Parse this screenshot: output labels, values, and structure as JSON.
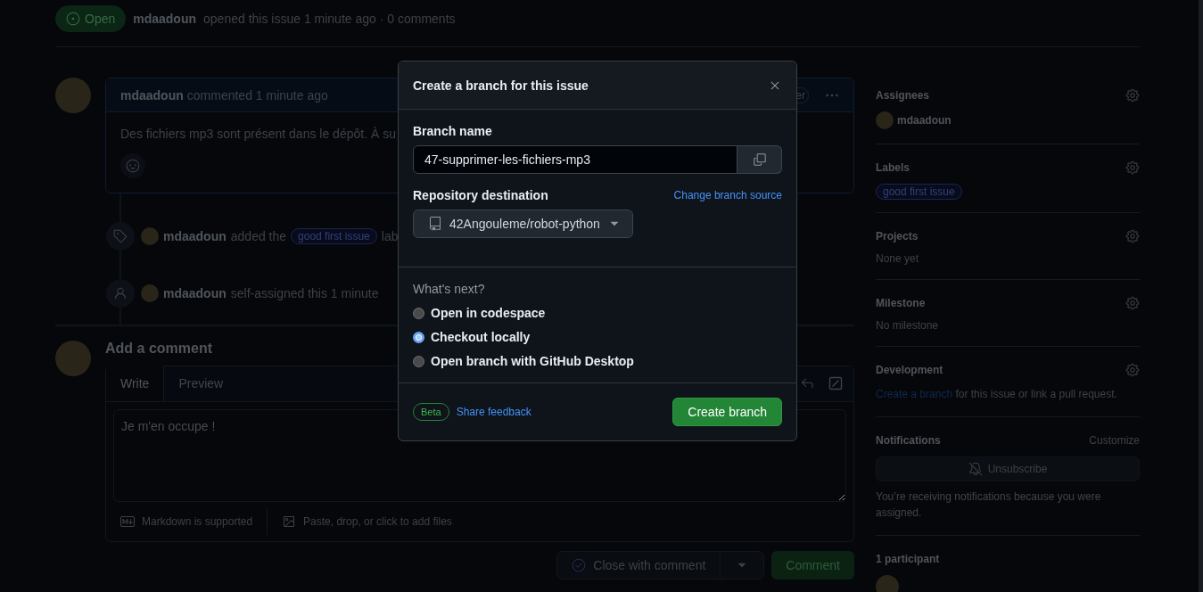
{
  "issue_header": {
    "state": "Open",
    "author": "mdaadoun",
    "meta": "opened this issue 1 minute ago · 0 comments"
  },
  "comment": {
    "author": "mdaadoun",
    "meta": "commented 1 minute ago",
    "role_badge": "er",
    "body": "Des fichiers mp3 sont présent dans le dépôt. À su"
  },
  "timeline": [
    {
      "kind": "label",
      "actor": "mdaadoun",
      "action": "added the",
      "label": "good first issue",
      "trailing": "lab"
    },
    {
      "kind": "assign",
      "actor": "mdaadoun",
      "action": "self-assigned this 1 minute"
    }
  ],
  "comment_form": {
    "title": "Add a comment",
    "tabs": [
      {
        "label": "Write",
        "selected": true
      },
      {
        "label": "Preview",
        "selected": false
      }
    ],
    "value": "Je m'en occupe !",
    "markdown_note": "Markdown is supported",
    "attach_note": "Paste, drop, or click to add files",
    "close_button": "Close with comment",
    "submit_button": "Comment"
  },
  "sidebar": {
    "sections": [
      {
        "kind": "assignees",
        "title": "Assignees",
        "users": [
          "mdaadoun"
        ]
      },
      {
        "kind": "labels",
        "title": "Labels",
        "labels": [
          "good first issue"
        ]
      },
      {
        "kind": "text",
        "title": "Projects",
        "text": "None yet"
      },
      {
        "kind": "text",
        "title": "Milestone",
        "text": "No milestone"
      },
      {
        "kind": "development",
        "title": "Development",
        "link": "Create a branch",
        "text": "for this issue or link a pull request."
      },
      {
        "kind": "notifications",
        "title": "Notifications",
        "action": "Customize",
        "button": "Unsubscribe",
        "note": "You’re receiving notifications because you were assigned."
      },
      {
        "kind": "participants",
        "title": "1 participant"
      }
    ]
  },
  "dialog": {
    "title": "Create a branch for this issue",
    "branch_label": "Branch name",
    "branch_value": "47-supprimer-les-fichiers-mp3",
    "repo_label": "Repository destination",
    "change_source": "Change branch source",
    "repo": "42Angouleme/robot-python",
    "next_label": "What's next?",
    "options": [
      {
        "label": "Open in codespace",
        "selected": false
      },
      {
        "label": "Checkout locally",
        "selected": true
      },
      {
        "label": "Open branch with GitHub Desktop",
        "selected": false
      }
    ],
    "beta": "Beta",
    "feedback": "Share feedback",
    "create_button": "Create branch"
  }
}
